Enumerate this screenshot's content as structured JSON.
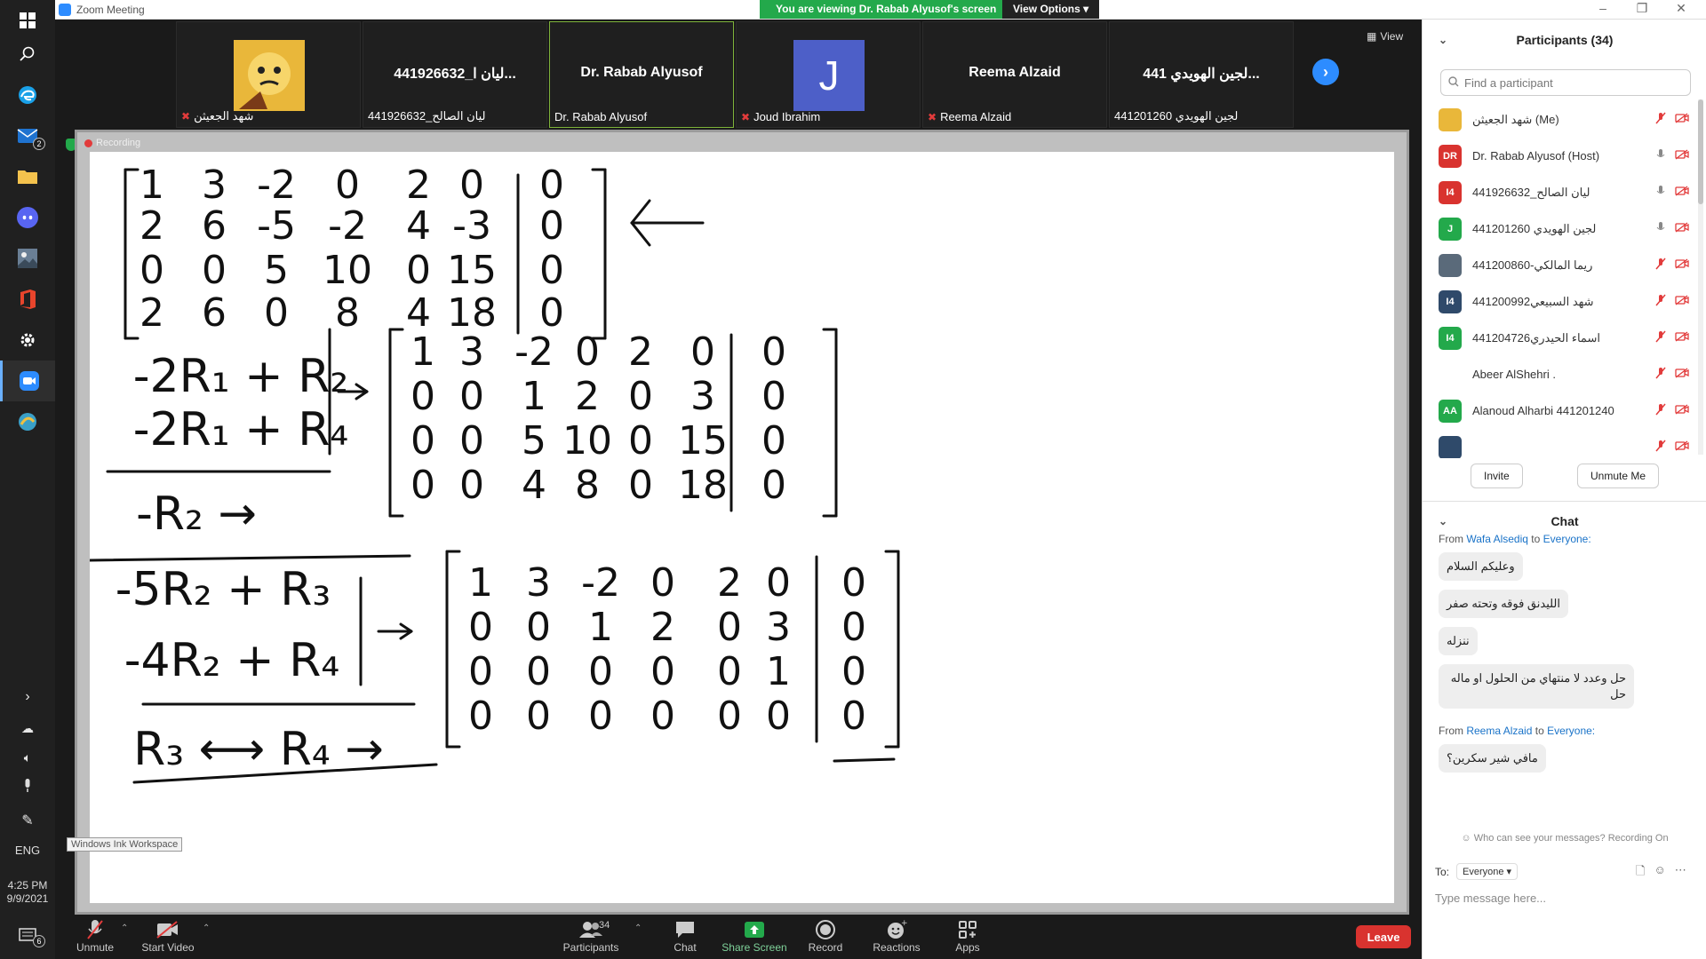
{
  "window": {
    "title": "Zoom Meeting",
    "viewing_banner": "You are viewing Dr. Rabab Alyusof's screen",
    "view_options": "View Options ▾",
    "minimize": "–",
    "restore": "❐",
    "close": "✕"
  },
  "taskbar": {
    "lang": "ENG",
    "time": "4:25 PM",
    "date": "9/9/2021",
    "mail_badge": "2",
    "notif_badge": "6"
  },
  "thumbnails": [
    {
      "center": "",
      "label": "شهد الجعيثن",
      "muted": true
    },
    {
      "center": "441926632_ليان ا...",
      "label": "441926632_ليان الصالح",
      "muted": false
    },
    {
      "center": "Dr. Rabab Alyusof",
      "label": "Dr. Rabab Alyusof",
      "muted": false
    },
    {
      "center": "J",
      "label": "Joud Ibrahim",
      "muted": true
    },
    {
      "center": "Reema Alzaid",
      "label": "Reema Alzaid",
      "muted": true
    },
    {
      "center": "لجين الهويدي 441...",
      "label": "441201260 لجين الهويدي",
      "muted": false
    }
  ],
  "view_btn": "View",
  "board": {
    "recording": "Recording",
    "ink_tooltip": "Windows Ink Workspace",
    "m1": [
      [
        "1",
        "3",
        "-2",
        "0",
        "2",
        "0",
        "0"
      ],
      [
        "2",
        "6",
        "-5",
        "-2",
        "4",
        "-3",
        "0"
      ],
      [
        "0",
        "0",
        "5",
        "10",
        "0",
        "15",
        "0"
      ],
      [
        "2",
        "6",
        "0",
        "8",
        "4",
        "18",
        "0"
      ]
    ],
    "m2": [
      [
        "1",
        "3",
        "-2",
        "0",
        "2",
        "0",
        "0"
      ],
      [
        "0",
        "0",
        "1",
        "2",
        "0",
        "3",
        "0"
      ],
      [
        "0",
        "0",
        "5",
        "10",
        "0",
        "15",
        "0"
      ],
      [
        "0",
        "0",
        "4",
        "8",
        "0",
        "18",
        "0"
      ]
    ],
    "m3": [
      [
        "1",
        "3",
        "-2",
        "0",
        "2",
        "0",
        "0"
      ],
      [
        "0",
        "0",
        "1",
        "2",
        "0",
        "3",
        "0"
      ],
      [
        "0",
        "0",
        "0",
        "0",
        "0",
        "1",
        "0"
      ],
      [
        "0",
        "0",
        "0",
        "0",
        "0",
        "0",
        "0"
      ]
    ],
    "op1": "-2R₁ + R₂",
    "op2": "-2R₁ + R₄",
    "op3": "-R₂ →",
    "op4": "-5R₂ + R₃",
    "op5": "-4R₂ + R₄",
    "op6": "R₃ ⟷ R₄ →"
  },
  "toolbar": {
    "unmute": "Unmute",
    "start_video": "Start Video",
    "participants": "Participants",
    "participants_count": "34",
    "chat": "Chat",
    "share_screen": "Share Screen",
    "record": "Record",
    "reactions": "Reactions",
    "apps": "Apps",
    "leave": "Leave"
  },
  "participants_panel": {
    "title": "Participants (34)",
    "search_placeholder": "Find a participant",
    "invite": "Invite",
    "unmute_me": "Unmute Me",
    "people": [
      {
        "initials": "",
        "name": "شهد الجعيثن (Me)",
        "color": "#e9b73a",
        "mic": "off",
        "cam": "off"
      },
      {
        "initials": "DR",
        "name": "Dr. Rabab Alyusof (Host)",
        "color": "#d9332f",
        "mic": "on",
        "cam": "off"
      },
      {
        "initials": "I4",
        "name": "441926632_ليان الصالح",
        "color": "#d9332f",
        "mic": "on",
        "cam": "off"
      },
      {
        "initials": "J",
        "name": "441201260 لجين الهويدي",
        "color": "#23a94b",
        "mic": "on",
        "cam": "off"
      },
      {
        "initials": "",
        "name": "441200860-ريما المالكي",
        "color": "#5a6a7a",
        "mic": "off",
        "cam": "off"
      },
      {
        "initials": "I4",
        "name": "441200992شهد السبيعي",
        "color": "#2f4a6a",
        "mic": "off",
        "cam": "off"
      },
      {
        "initials": "I4",
        "name": "441204726اسماء الحيدري",
        "color": "#23a94b",
        "mic": "off",
        "cam": "off"
      },
      {
        "initials": "",
        "name": "Abeer AlShehri .",
        "color": "#ffffff",
        "mic": "off",
        "cam": "off"
      },
      {
        "initials": "AA",
        "name": "Alanoud Alharbi 441201240",
        "color": "#23a94b",
        "mic": "off",
        "cam": "off"
      },
      {
        "initials": "",
        "name": "",
        "color": "#2f4a6a",
        "mic": "off",
        "cam": "off"
      }
    ]
  },
  "chat_panel": {
    "title": "Chat",
    "msg_groups": [
      {
        "from": "From",
        "sender": "Wafa Alsediq",
        "to": "to",
        "recipient": "Everyone:"
      },
      {
        "from": "From",
        "sender": "Reema Alzaid",
        "to": "to",
        "recipient": "Everyone:"
      }
    ],
    "messages": [
      "وعليكم السلام",
      "الليدنق فوقه وتحته صفر",
      "ننزله",
      "حل وعدد لا منتهاي من الحلول او ماله حل",
      "مافي شير سكرين؟"
    ],
    "visibility_note": "Who can see your messages? Recording On",
    "to_label": "To:",
    "to_value": "Everyone ▾",
    "input_placeholder": "Type message here..."
  }
}
